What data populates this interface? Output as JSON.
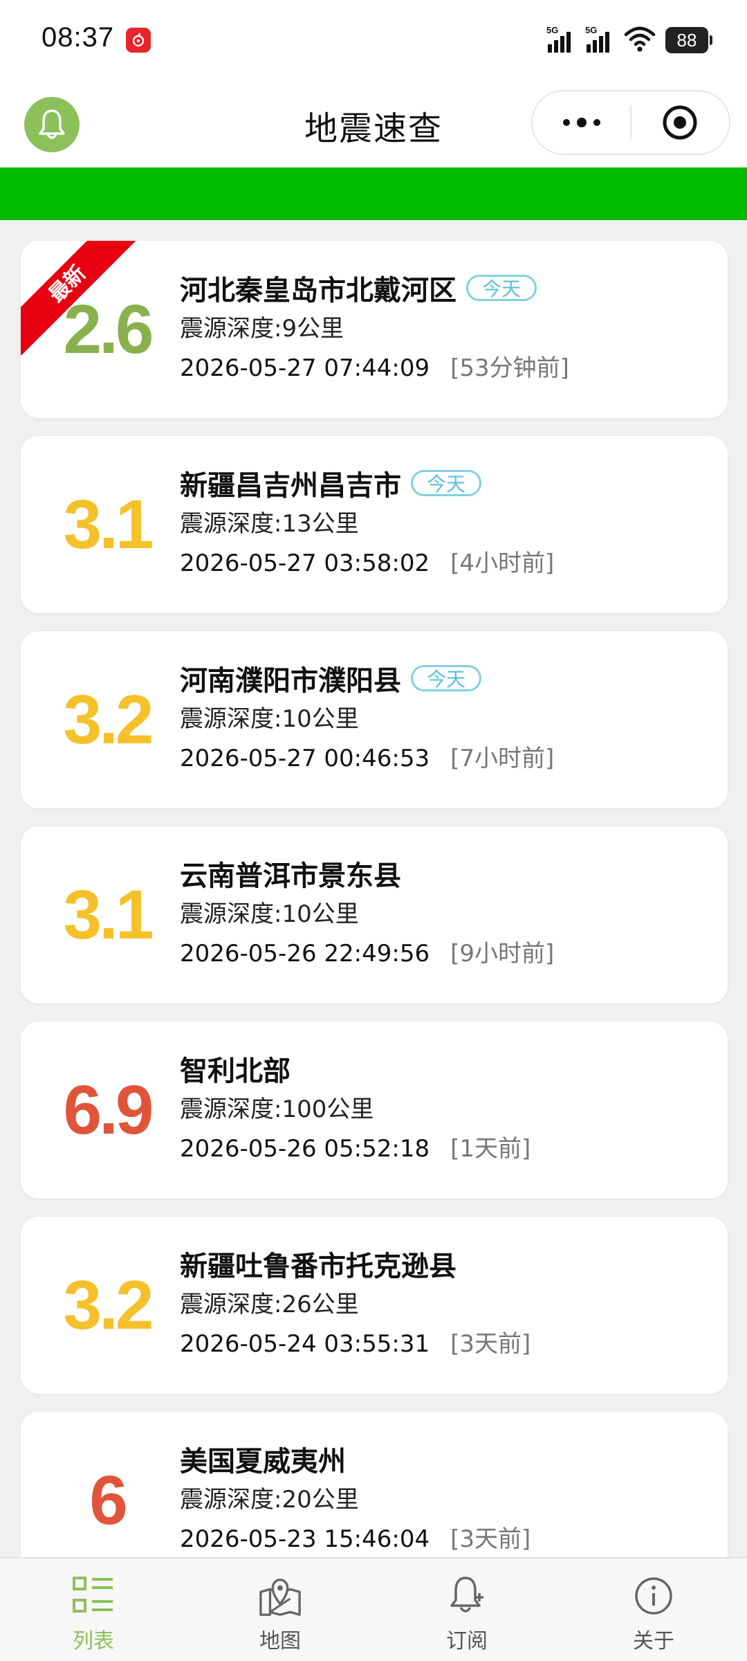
{
  "status_bar": {
    "time": "08:37",
    "signal1_label": "5G",
    "signal2_label": "5G",
    "battery": "88"
  },
  "nav": {
    "title": "地震速查"
  },
  "colors": {
    "accent_green": "#8cc05a",
    "banner_green": "#00bb00",
    "mag_low": "#8ab04e",
    "mag_mid": "#f5c12a",
    "mag_high": "#e0543a",
    "ribbon_red": "#e60012",
    "badge_blue": "#5bbfd6"
  },
  "list": {
    "ribbon_label": "最新",
    "today_badge": "今天",
    "items": [
      {
        "magnitude": "2.6",
        "place": "河北秦皇岛市北戴河区",
        "depth": "震源深度:9公里",
        "time": "2026-05-27 07:44:09",
        "ago": "[53分钟前]",
        "today": true,
        "latest": true,
        "level": "low"
      },
      {
        "magnitude": "3.1",
        "place": "新疆昌吉州昌吉市",
        "depth": "震源深度:13公里",
        "time": "2026-05-27 03:58:02",
        "ago": "[4小时前]",
        "today": true,
        "latest": false,
        "level": "mid"
      },
      {
        "magnitude": "3.2",
        "place": "河南濮阳市濮阳县",
        "depth": "震源深度:10公里",
        "time": "2026-05-27 00:46:53",
        "ago": "[7小时前]",
        "today": true,
        "latest": false,
        "level": "mid"
      },
      {
        "magnitude": "3.1",
        "place": "云南普洱市景东县",
        "depth": "震源深度:10公里",
        "time": "2026-05-26 22:49:56",
        "ago": "[9小时前]",
        "today": false,
        "latest": false,
        "level": "mid"
      },
      {
        "magnitude": "6.9",
        "place": "智利北部",
        "depth": "震源深度:100公里",
        "time": "2026-05-26 05:52:18",
        "ago": "[1天前]",
        "today": false,
        "latest": false,
        "level": "high"
      },
      {
        "magnitude": "3.2",
        "place": "新疆吐鲁番市托克逊县",
        "depth": "震源深度:26公里",
        "time": "2026-05-24 03:55:31",
        "ago": "[3天前]",
        "today": false,
        "latest": false,
        "level": "mid"
      },
      {
        "magnitude": "6",
        "place": "美国夏威夷州",
        "depth": "震源深度:20公里",
        "time": "2026-05-23 15:46:04",
        "ago": "[3天前]",
        "today": false,
        "latest": false,
        "level": "high"
      }
    ]
  },
  "tabs": [
    {
      "label": "列表",
      "icon": "list-icon",
      "active": true
    },
    {
      "label": "地图",
      "icon": "map-icon",
      "active": false
    },
    {
      "label": "订阅",
      "icon": "bell-plus-icon",
      "active": false
    },
    {
      "label": "关于",
      "icon": "info-icon",
      "active": false
    }
  ]
}
